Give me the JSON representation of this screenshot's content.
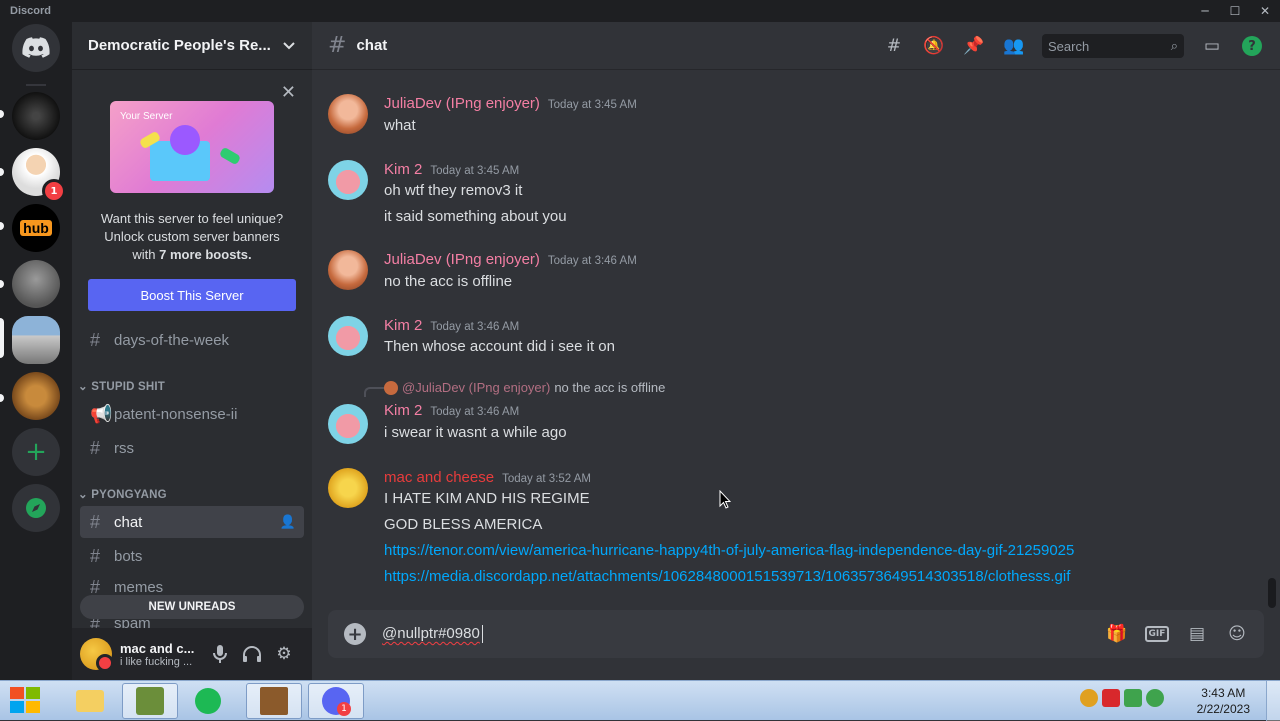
{
  "window": {
    "app_name": "Discord",
    "minimize": "─",
    "maximize": "☐",
    "close": "✕"
  },
  "guilds": {
    "dm_icon": "discord-logo",
    "badge_count": "1",
    "add_server": "+",
    "explore": "compass"
  },
  "server": {
    "name": "Democratic People's Re...",
    "boost": {
      "text_line1": "Want this server to feel unique?",
      "text_line2": "Unlock custom server banners",
      "text_line3_pre": "with ",
      "text_line3_bold": "7 more boosts.",
      "button": "Boost This Server",
      "art_label": "Your Server"
    },
    "channels": [
      {
        "name": "days-of-the-week",
        "icon": "#"
      },
      {
        "category": "STUPID SHIT"
      },
      {
        "name": "patent-nonsense-ii",
        "icon": "megaphone"
      },
      {
        "name": "rss",
        "icon": "#"
      },
      {
        "category": "PYONGYANG"
      },
      {
        "name": "chat",
        "icon": "#",
        "active": true
      },
      {
        "name": "bots",
        "icon": "#"
      },
      {
        "name": "memes",
        "icon": "#"
      },
      {
        "name": "spam",
        "icon": "#"
      }
    ],
    "category_stupid": "STUPID SHIT",
    "category_pyongyang": "PYONGYANG",
    "new_unreads": "NEW UNREADS"
  },
  "user": {
    "name": "mac and c...",
    "status": "i like fucking ..."
  },
  "channel": {
    "name": "chat",
    "search_placeholder": "Search"
  },
  "messages": [
    {
      "author": "JuliaDev (IPng enjoyer)",
      "time": "Today at 3:45 AM",
      "lines": [
        "what"
      ]
    },
    {
      "author": "Kim 2",
      "time": "Today at 3:45 AM",
      "lines": [
        "oh wtf they remov3 it",
        "it said something about you"
      ]
    },
    {
      "author": "JuliaDev (IPng enjoyer)",
      "time": "Today at 3:46 AM",
      "lines": [
        "no the acc is offline"
      ]
    },
    {
      "author": "Kim 2",
      "time": "Today at 3:46 AM",
      "lines": [
        "Then whose account did i see it on"
      ]
    },
    {
      "reply_to": "@JuliaDev (IPng enjoyer)",
      "reply_text": "no the acc is offline",
      "author": "Kim 2",
      "time": "Today at 3:46 AM",
      "lines": [
        "i swear it wasnt a while ago"
      ]
    },
    {
      "author": "mac and cheese",
      "time": "Today at 3:52 AM",
      "lines": [
        "I HATE KIM AND HIS REGIME",
        "GOD BLESS AMERICA"
      ],
      "links": [
        "https://tenor.com/view/america-hurricane-happy4th-of-july-america-flag-independence-day-gif-21259025",
        "https://media.discordapp.net/attachments/1062848000151539713/1063573649514303518/clothesss.gif"
      ]
    }
  ],
  "composer": {
    "text": "@nullptr#0980",
    "gif": "GIF"
  },
  "taskbar": {
    "time": "3:43 AM",
    "date": "2/22/2023",
    "discord_badge": "1"
  },
  "colors": {
    "accent": "#5865f2",
    "kim_name": "#f47fa4",
    "mac_name": "#e83c3c",
    "link": "#00a8fc"
  }
}
